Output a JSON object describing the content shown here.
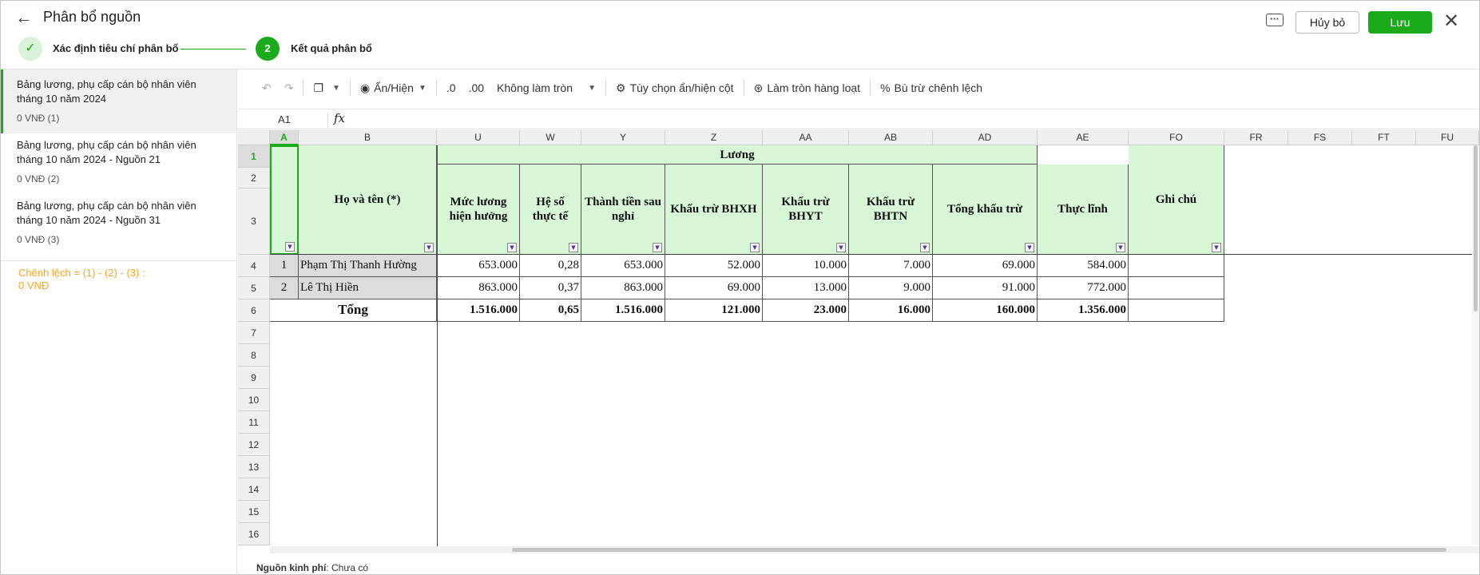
{
  "header": {
    "title": "Phân bổ nguồn",
    "steps": [
      {
        "number": "✓",
        "label": "Xác định tiêu chí phân bổ"
      },
      {
        "number": "2",
        "label": "Kết quả phân bổ"
      }
    ],
    "cancel_label": "Hủy bỏ",
    "save_label": "Lưu"
  },
  "sidebar": {
    "items": [
      {
        "title": "Bảng lương, phụ cấp cán bộ nhân viên tháng 10 năm 2024",
        "amount": "0 VNĐ (1)"
      },
      {
        "title": "Bảng lương, phụ cấp cán bộ nhân viên tháng 10 năm 2024 - Nguồn 21",
        "amount": "0 VNĐ (2)"
      },
      {
        "title": "Bảng lương, phụ cấp cán bộ nhân viên tháng 10 năm 2024 - Nguồn 31",
        "amount": "0 VNĐ (3)"
      }
    ],
    "difference_label": "Chênh lệch = (1) - (2) - (3) :",
    "difference_value": "0 VNĐ"
  },
  "toolbar": {
    "show_hide": "Ẩn/Hiện",
    "decrease_decimal": ".0",
    "increase_decimal": ".00",
    "rounding": "Không làm tròn",
    "column_options": "Tùy chọn ẩn/hiện cột",
    "bulk_round": "Làm tròn hàng loạt",
    "offset_difference": "Bù trừ chênh lệch"
  },
  "formula_bar": {
    "cell_ref": "A1",
    "fx": "fx"
  },
  "grid": {
    "columns": [
      "A",
      "B",
      "U",
      "W",
      "Y",
      "Z",
      "AA",
      "AB",
      "AD",
      "AE",
      "FO",
      "FR",
      "FS",
      "FT",
      "FU"
    ],
    "row_numbers": [
      "1",
      "2",
      "3",
      "4",
      "5",
      "6",
      "7",
      "8",
      "9",
      "10",
      "11",
      "12",
      "13",
      "14",
      "15",
      "16"
    ],
    "group_header": "Lương",
    "name_header": "Họ và tên (*)",
    "note_header": "Ghi chú",
    "sub_headers": [
      "Mức lương hiện hưởng",
      "Hệ số thực tế",
      "Thành tiền sau nghỉ",
      "Khấu trừ BHXH",
      "Khấu trừ BHYT",
      "Khấu trừ BHTN",
      "Tổng khấu trừ",
      "Thực lĩnh"
    ],
    "rows": [
      {
        "stt": "1",
        "name": "Phạm Thị Thanh  Hường",
        "values": [
          "653.000",
          "0,28",
          "653.000",
          "52.000",
          "10.000",
          "7.000",
          "69.000",
          "584.000"
        ]
      },
      {
        "stt": "2",
        "name": "Lê Thị Hiền",
        "values": [
          "863.000",
          "0,37",
          "863.000",
          "69.000",
          "13.000",
          "9.000",
          "91.000",
          "772.000"
        ]
      }
    ],
    "total_label": "Tổng",
    "totals": [
      "1.516.000",
      "0,65",
      "1.516.000",
      "121.000",
      "23.000",
      "16.000",
      "160.000",
      "1.356.000"
    ]
  },
  "footer": {
    "label": "Nguồn kinh phí",
    "value": "Chưa có"
  }
}
